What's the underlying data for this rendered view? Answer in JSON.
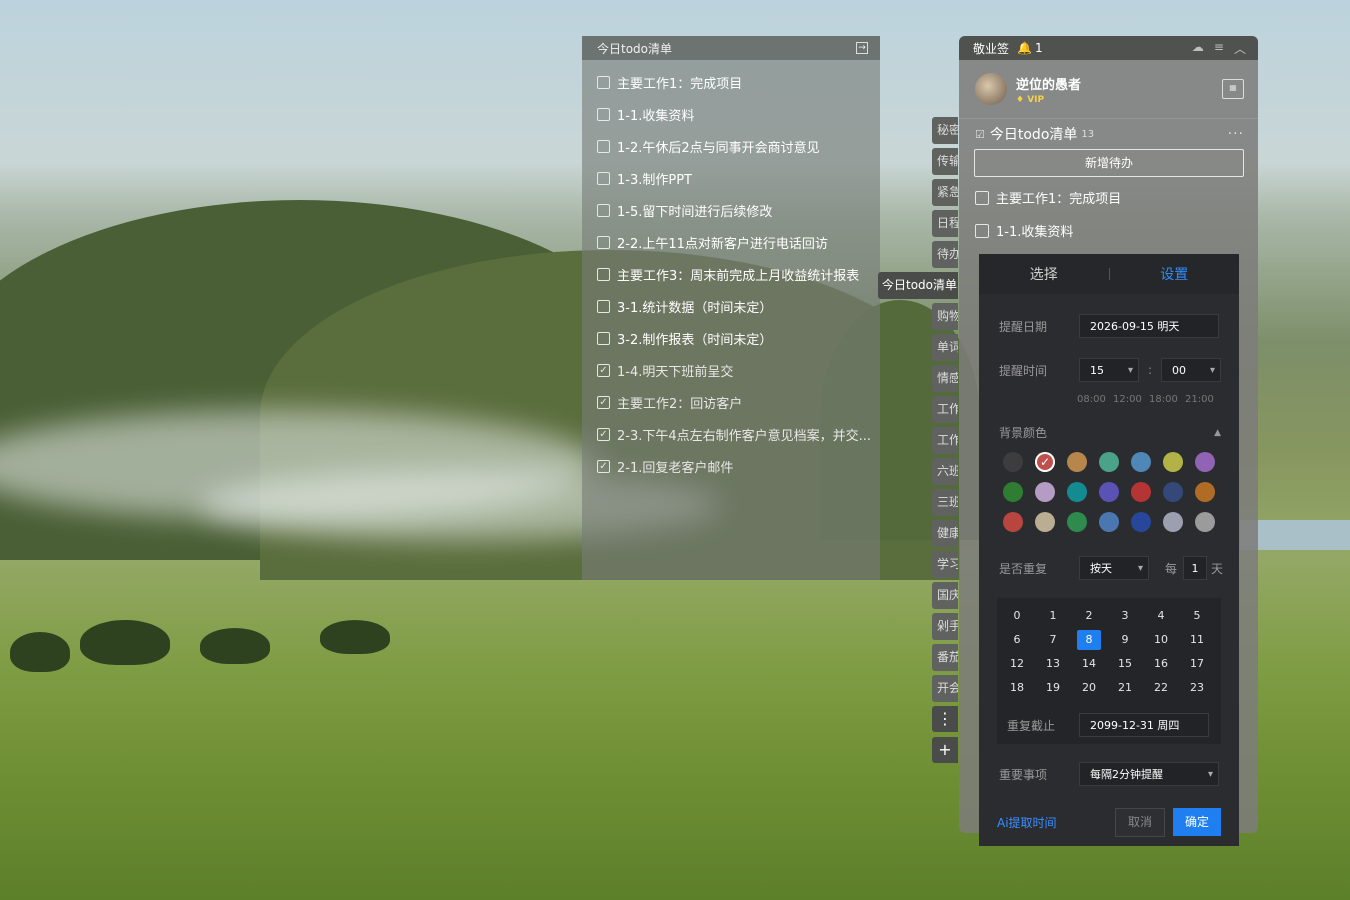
{
  "left_panel": {
    "title": "今日todo清单",
    "items": [
      {
        "text": "主要工作1：完成项目",
        "done": false
      },
      {
        "text": "1-1.收集资料",
        "done": false
      },
      {
        "text": "1-2.午休后2点与同事开会商讨意见",
        "done": false
      },
      {
        "text": "1-3.制作PPT",
        "done": false
      },
      {
        "text": "1-5.留下时间进行后续修改",
        "done": false
      },
      {
        "text": "2-2.上午11点对新客户进行电话回访",
        "done": false
      },
      {
        "text": "主要工作3：周末前完成上月收益统计报表",
        "done": false
      },
      {
        "text": "3-1.统计数据（时间未定）",
        "done": false
      },
      {
        "text": "3-2.制作报表（时间未定）",
        "done": false
      },
      {
        "text": "1-4.明天下班前呈交",
        "done": true
      },
      {
        "text": "主要工作2：回访客户",
        "done": true
      },
      {
        "text": "2-3.下午4点左右制作客户意见档案，并交...",
        "done": true
      },
      {
        "text": "2-1.回复老客户邮件",
        "done": true
      }
    ]
  },
  "side_tabs": {
    "active": "今日todo清单",
    "tabs": [
      "秘密",
      "传输",
      "紧急",
      "日程",
      "待办",
      "购物",
      "单词",
      "情感",
      "工作",
      "工作",
      "六班",
      "三班",
      "健康",
      "学习",
      "国庆",
      "剁手",
      "番茄",
      "开会"
    ],
    "more_icon": "⋮",
    "add_icon": "+"
  },
  "app": {
    "name": "敬业签",
    "notification_count": "1",
    "username": "逆位的愚者",
    "vip": "VIP",
    "list_title": "今日todo清单",
    "list_count": "13",
    "add_button": "新增待办",
    "items": [
      "主要工作1：完成项目",
      "1-1.收集资料"
    ]
  },
  "popup": {
    "tab_select": "选择",
    "tab_settings": "设置",
    "remind_date_label": "提醒日期",
    "remind_date_value": "2026-09-15 明天",
    "remind_time_label": "提醒时间",
    "hour_value": "15",
    "minute_value": "00",
    "time_colon": ":",
    "quick_times": "08:00 12:00 18:00 21:00",
    "bg_color_label": "背景颜色",
    "colors": [
      "#3d3d40",
      "#c0504d",
      "#b7864c",
      "#4aa389",
      "#4f87b7",
      "#b2b247",
      "#9063b5",
      "#2e7d33",
      "#b49cc4",
      "#148a91",
      "#5b52b5",
      "#b53434",
      "#34497a",
      "#b06b25",
      "#b84540",
      "#b9ad92",
      "#2f8a4e",
      "#4a77b0",
      "#27489a",
      "#9c9fb0",
      "#9b9b9b"
    ],
    "selected_color_index": 1,
    "repeat_label": "是否重复",
    "repeat_value": "按天",
    "every_label": "每",
    "every_value": "1",
    "day_unit": "天",
    "hours": [
      "0",
      "1",
      "2",
      "3",
      "4",
      "5",
      "6",
      "7",
      "8",
      "9",
      "10",
      "11",
      "12",
      "13",
      "14",
      "15",
      "16",
      "17",
      "18",
      "19",
      "20",
      "21",
      "22",
      "23"
    ],
    "selected_hour": "8",
    "repeat_end_label": "重复截止",
    "repeat_end_value": "2099-12-31 周四",
    "important_label": "重要事项",
    "important_value": "每隔2分钟提醒",
    "ai_link": "Ai提取时间",
    "cancel": "取消",
    "confirm": "确定"
  }
}
